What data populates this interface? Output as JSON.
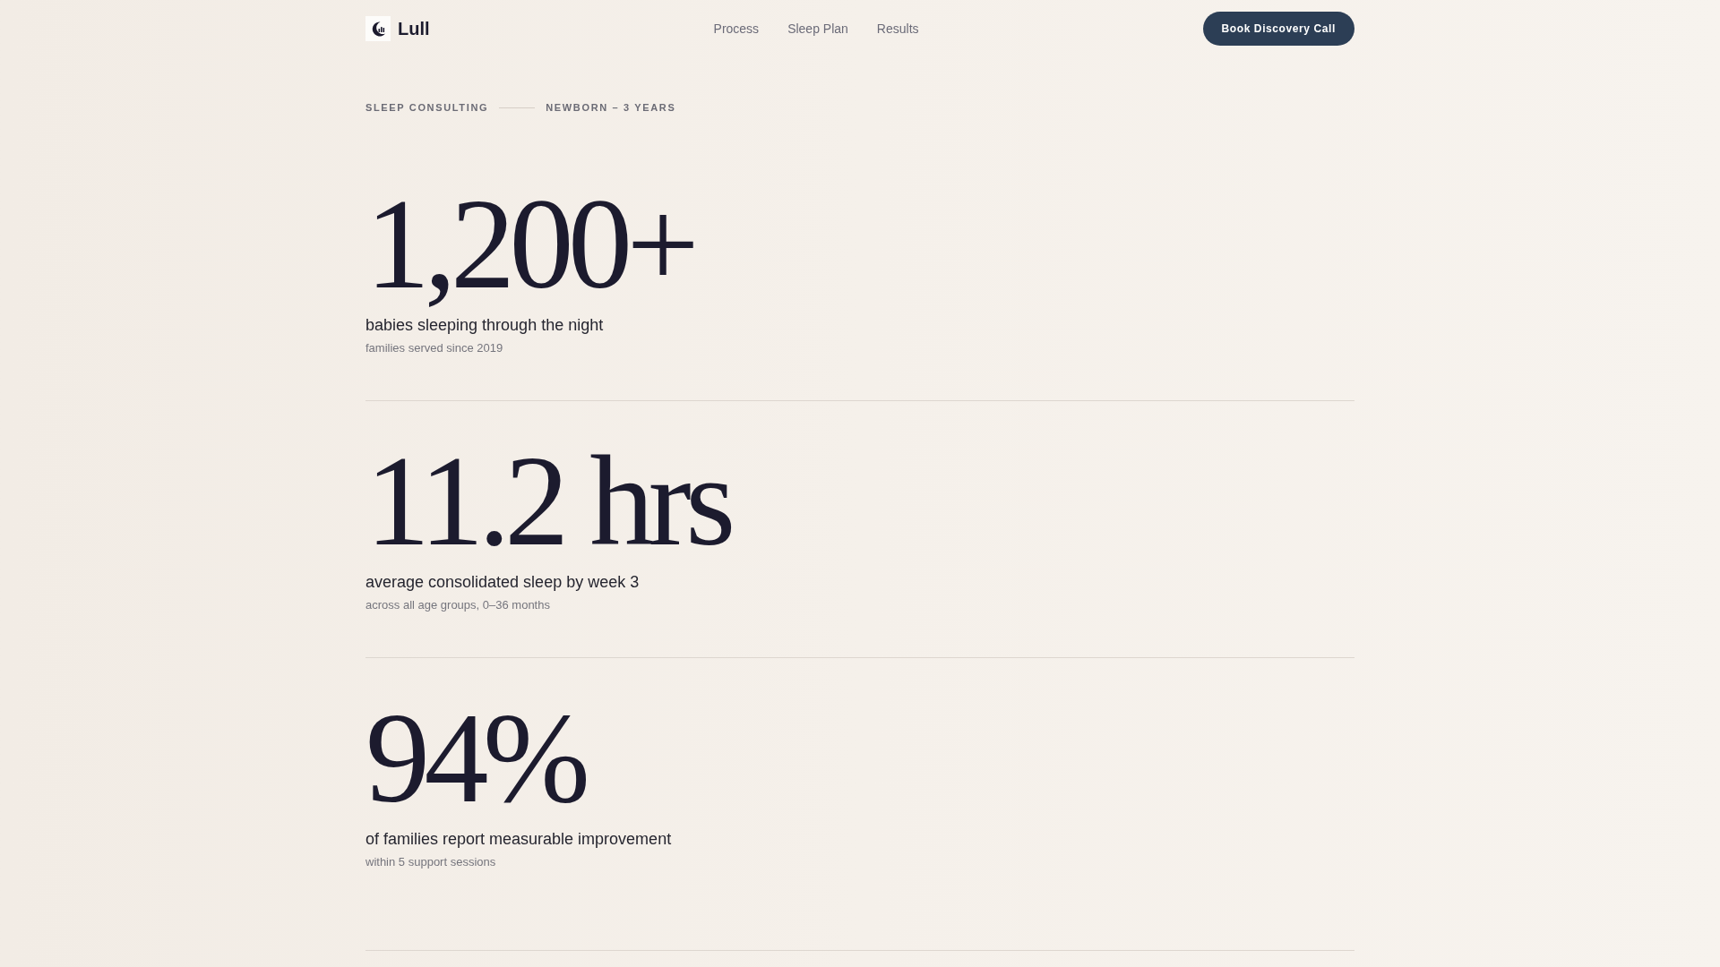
{
  "header": {
    "logo": {
      "name": "Lull"
    },
    "nav": [
      {
        "label": "Process"
      },
      {
        "label": "Sleep Plan"
      },
      {
        "label": "Results"
      }
    ],
    "cta": {
      "label": "Book Discovery Call"
    }
  },
  "eyebrow": {
    "category": "SLEEP CONSULTING",
    "audience": "NEWBORN – 3 YEARS"
  },
  "stats": [
    {
      "value": "1,200+",
      "label": "babies sleeping through the night",
      "note": "families served since 2019"
    },
    {
      "value": "11.2 hrs",
      "label": "average consolidated sleep by week 3",
      "note": "across all age groups, 0–36 months"
    },
    {
      "value": "94%",
      "label": "of families report measurable improvement",
      "note": "within 5 support sessions"
    }
  ]
}
